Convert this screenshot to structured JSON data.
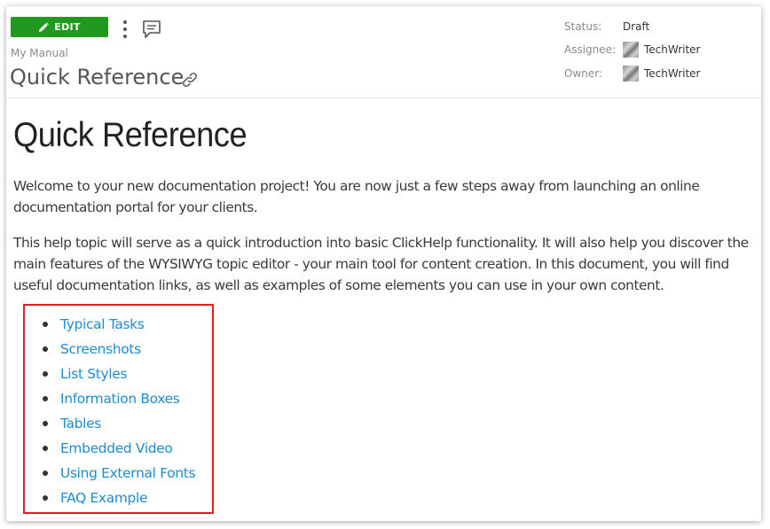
{
  "header": {
    "edit_label": "EDIT",
    "breadcrumb": "My Manual",
    "title": "Quick Reference"
  },
  "meta": {
    "status_label": "Status:",
    "status_value": "Draft",
    "assignee_label": "Assignee:",
    "assignee_value": "TechWriter",
    "owner_label": "Owner:",
    "owner_value": "TechWriter"
  },
  "content": {
    "heading": "Quick Reference",
    "para1_lines": [
      "Welcome to your new documentation project! You are now just a few steps away from launching an online",
      "documentation portal for your clients."
    ],
    "para2_lines": [
      "This help topic will serve as a quick introduction into basic ClickHelp functionality. It will also help you discover the",
      "main features of the WYSIWYG topic editor - your main tool for content creation. In this document, you will find",
      "useful documentation links, as well as examples of some elements you can use in your own content."
    ],
    "toc": [
      "Typical Tasks",
      "Screenshots",
      "List Styles",
      "Information Boxes",
      "Tables",
      "Embedded Video",
      "Using External Fonts",
      "FAQ Example"
    ]
  },
  "icons": {
    "edit": "pencil-icon",
    "more": "more-vertical-icon",
    "comment": "comment-icon",
    "link": "link-icon"
  },
  "colors": {
    "edit_button": "#1f9a1f",
    "link": "#1e8bd2",
    "highlight_border": "#e01f26"
  }
}
